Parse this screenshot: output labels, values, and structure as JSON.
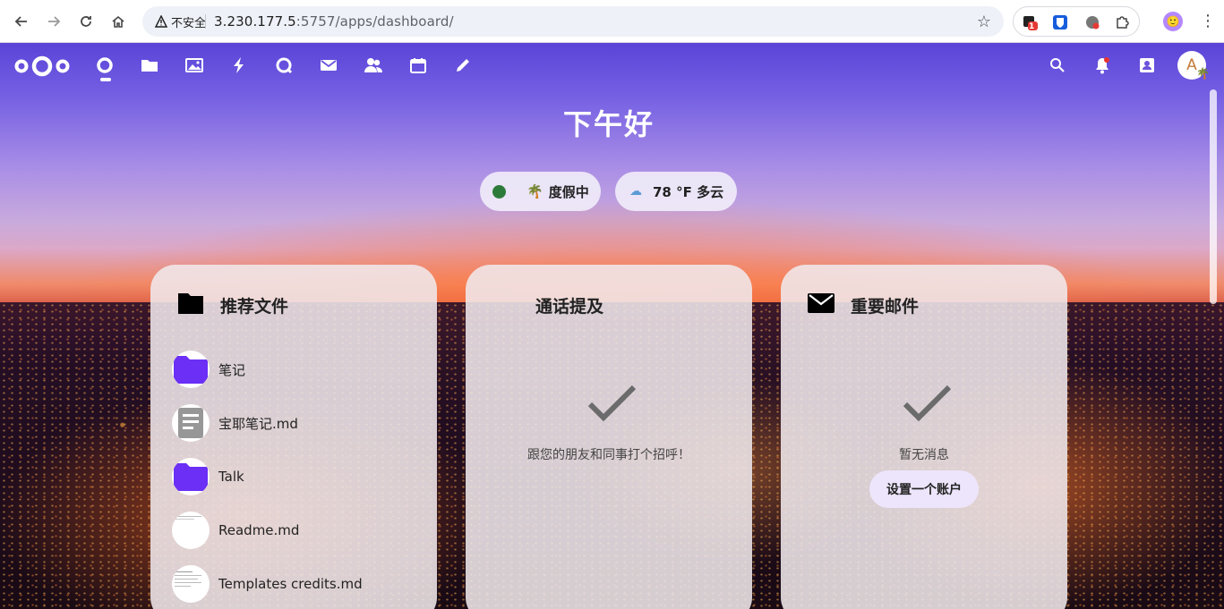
{
  "browser": {
    "security_label": "不安全",
    "url_host": "3.230.177.5",
    "url_rest": ":5757/apps/dashboard/",
    "extension_badge": "1"
  },
  "header": {
    "apps": [
      {
        "name": "dashboard-icon"
      },
      {
        "name": "files-icon"
      },
      {
        "name": "photos-icon"
      },
      {
        "name": "activity-icon"
      },
      {
        "name": "talk-icon"
      },
      {
        "name": "mail-icon"
      },
      {
        "name": "contacts-icon"
      },
      {
        "name": "calendar-icon"
      },
      {
        "name": "notes-icon"
      }
    ],
    "avatar_letter": "A",
    "avatar_status": "🌴"
  },
  "dashboard": {
    "greeting": "下午好",
    "status": {
      "emoji": "🌴",
      "label": "度假中",
      "color": "#2d7b3a"
    },
    "weather": {
      "icon": "☁",
      "label": "78 °F 多云"
    }
  },
  "widgets": {
    "recommended": {
      "title": "推荐文件",
      "files": [
        {
          "name": "笔记",
          "type": "folder"
        },
        {
          "name": "宝耶笔记.md",
          "type": "text"
        },
        {
          "name": "Talk",
          "type": "folder"
        },
        {
          "name": "Readme.md",
          "type": "doc"
        },
        {
          "name": "Templates credits.md",
          "type": "doc"
        }
      ]
    },
    "mentions": {
      "title": "通话提及",
      "empty": "跟您的朋友和同事打个招呼！"
    },
    "mail": {
      "title": "重要邮件",
      "empty": "暂无消息",
      "button": "设置一个账户"
    }
  },
  "colors": {
    "accent": "#6b2ff5",
    "folder": "#6b2ff5"
  }
}
